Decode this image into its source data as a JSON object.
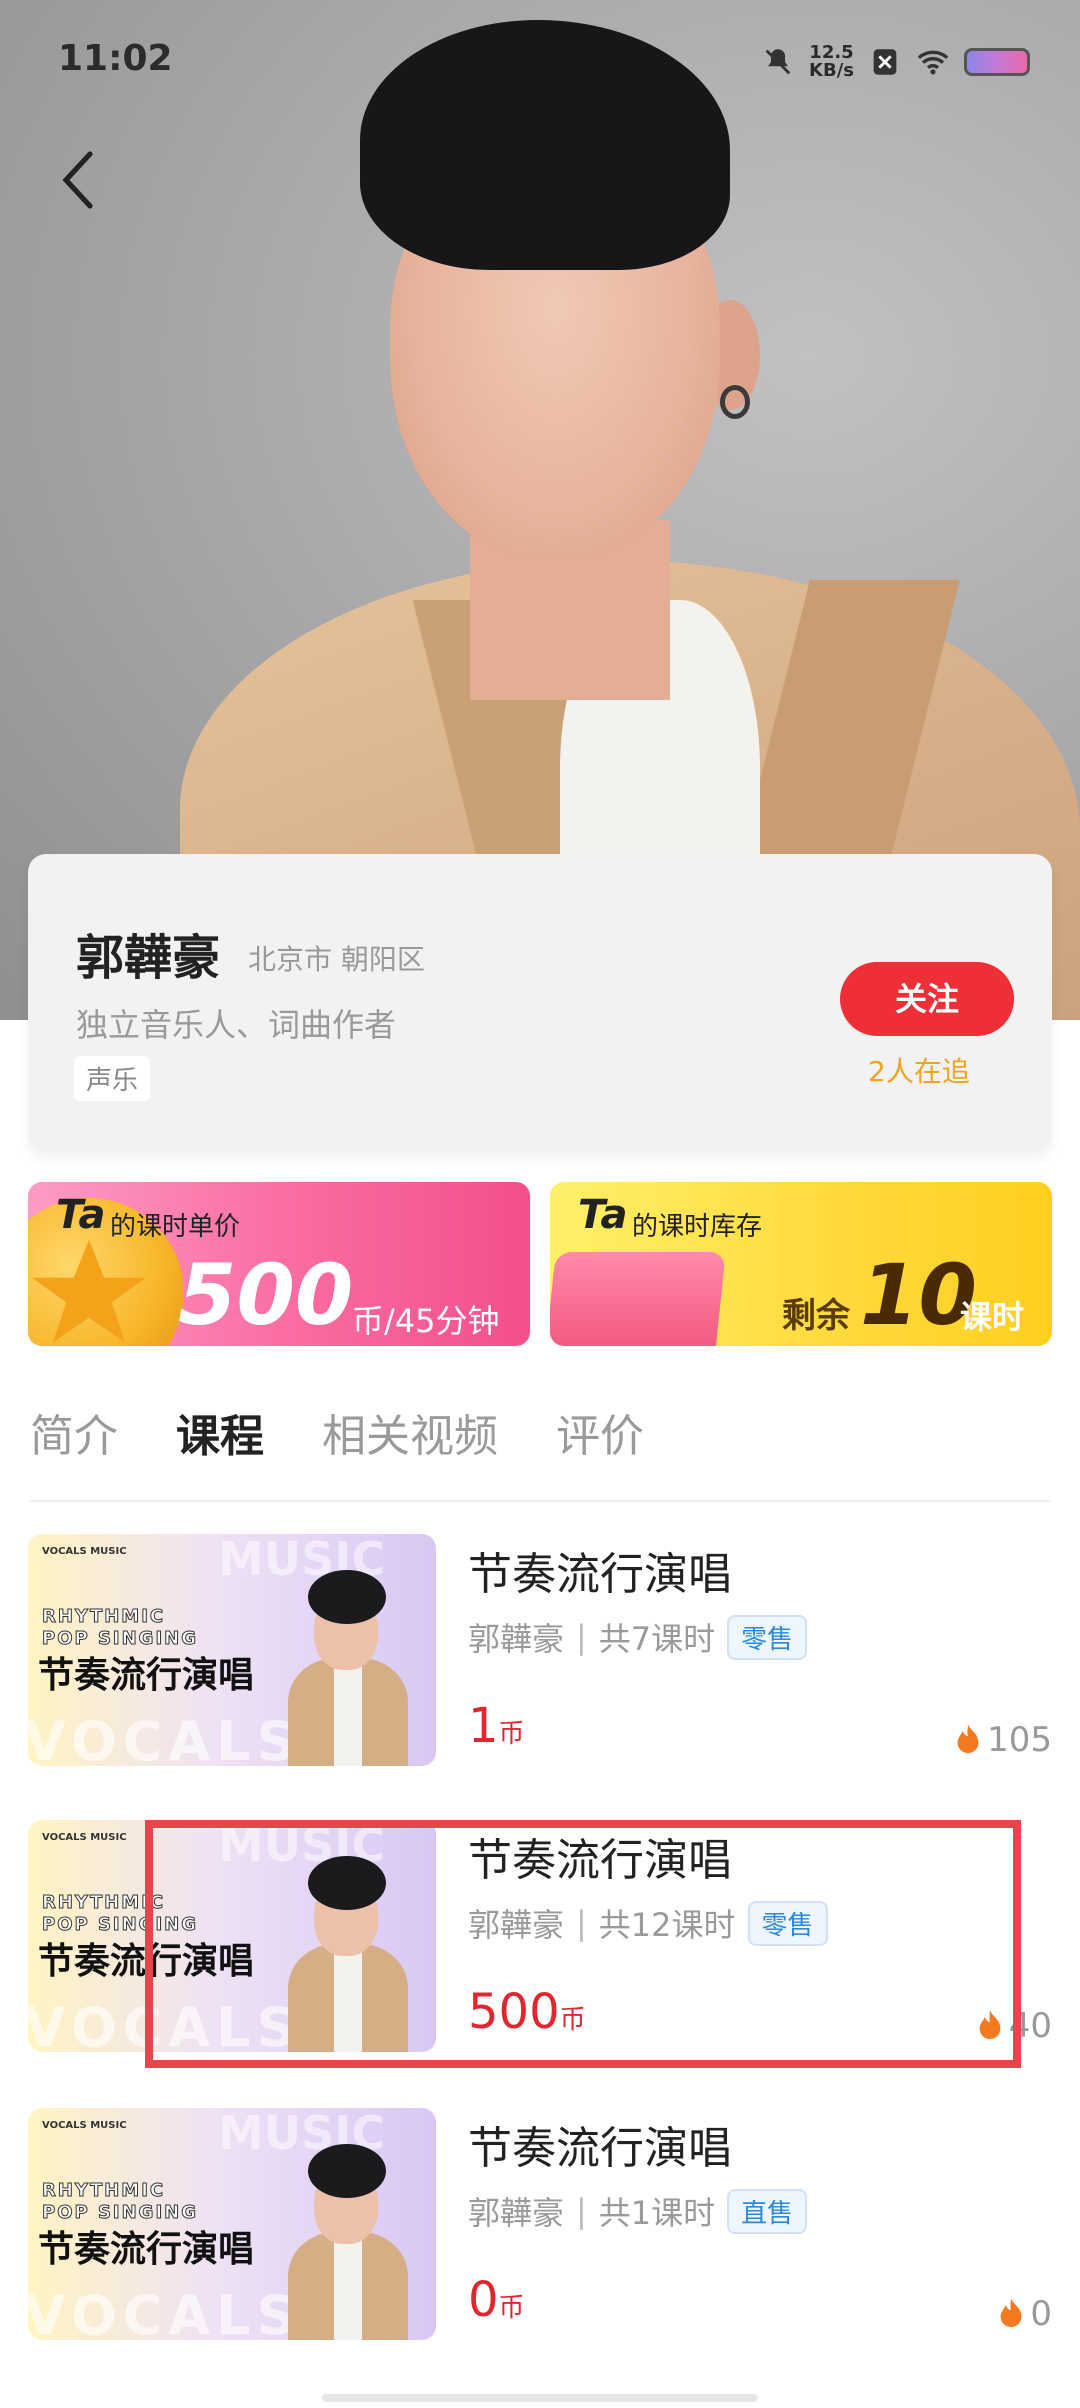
{
  "status_bar": {
    "time": "11:02",
    "net_speed_value": "12.5",
    "net_speed_unit": "KB/s"
  },
  "teacher": {
    "name": "郭韡豪",
    "location": "北京市 朝阳区",
    "title": "独立音乐人、词曲作者",
    "tag": "声乐",
    "follow_label": "关注",
    "followers_text": "2人在追"
  },
  "price_card": {
    "ta": "Ta",
    "label": "的课时单价",
    "value": "500",
    "unit": "币/45分钟"
  },
  "stock_card": {
    "ta": "Ta",
    "label": "的课时库存",
    "prefix": "剩余",
    "value": "10",
    "unit": "课时"
  },
  "tabs": [
    {
      "label": "简介"
    },
    {
      "label": "课程"
    },
    {
      "label": "相关视频"
    },
    {
      "label": "评价"
    }
  ],
  "thumbnail": {
    "brand": "VOCALS MUSIC",
    "eng_line1": "RHYTHMIC",
    "eng_line2": "POP SINGING",
    "cn": "节奏流行演唱",
    "bg_text_bottom": "VOCALS",
    "bg_text_top": "MUSIC"
  },
  "courses": [
    {
      "title": "节奏流行演唱",
      "teacher": "郭韡豪",
      "sep": "|",
      "lessons": "共7课时",
      "badge": "零售",
      "price": "1",
      "price_unit": "币",
      "heat": "105"
    },
    {
      "title": "节奏流行演唱",
      "teacher": "郭韡豪",
      "sep": "|",
      "lessons": "共12课时",
      "badge": "零售",
      "price": "500",
      "price_unit": "币",
      "heat": "40"
    },
    {
      "title": "节奏流行演唱",
      "teacher": "郭韡豪",
      "sep": "|",
      "lessons": "共1课时",
      "badge": "直售",
      "price": "0",
      "price_unit": "币",
      "heat": "0"
    }
  ],
  "colors": {
    "accent_red": "#ef2f37",
    "price_red": "#e1262f",
    "follower_orange": "#f1a41d",
    "badge_blue": "#2f88d6"
  }
}
